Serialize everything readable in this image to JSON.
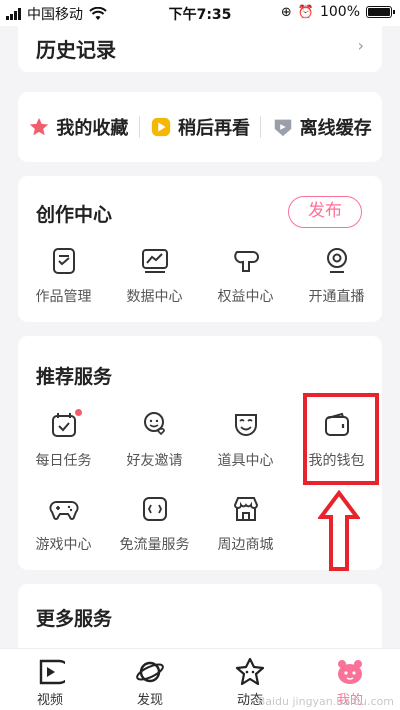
{
  "status_bar": {
    "carrier": "中国移动",
    "time": "下午7:35",
    "battery": "100%",
    "battery_level": 1.0
  },
  "history": {
    "title": "历史记录",
    "chevron": "›"
  },
  "quick_actions": [
    {
      "label": "我的收藏",
      "icon": "star-icon",
      "color": "#f25d6e"
    },
    {
      "label": "稍后再看",
      "icon": "watch-later-icon",
      "color": "#f5b800"
    },
    {
      "label": "离线缓存",
      "icon": "download-icon",
      "color": "#9aa0aa"
    }
  ],
  "creation_center": {
    "title": "创作中心",
    "publish_label": "发布",
    "items": [
      {
        "label": "作品管理",
        "icon": "works-icon"
      },
      {
        "label": "数据中心",
        "icon": "data-chart-icon"
      },
      {
        "label": "权益中心",
        "icon": "benefits-icon"
      },
      {
        "label": "开通直播",
        "icon": "live-camera-icon"
      }
    ]
  },
  "recommended": {
    "title": "推荐服务",
    "items": [
      {
        "label": "每日任务",
        "icon": "calendar-task-icon",
        "badge": true
      },
      {
        "label": "好友邀请",
        "icon": "friend-invite-icon"
      },
      {
        "label": "道具中心",
        "icon": "mask-icon"
      },
      {
        "label": "我的钱包",
        "icon": "wallet-icon"
      },
      {
        "label": "游戏中心",
        "icon": "gamepad-icon"
      },
      {
        "label": "免流量服务",
        "icon": "free-data-icon"
      },
      {
        "label": "周边商城",
        "icon": "shop-icon"
      }
    ]
  },
  "more_services": {
    "title": "更多服务"
  },
  "bottom_nav": [
    {
      "label": "视频",
      "icon": "video-icon"
    },
    {
      "label": "发现",
      "icon": "planet-icon"
    },
    {
      "label": "动态",
      "icon": "star-face-icon"
    },
    {
      "label": "我的",
      "icon": "profile-mascot-icon",
      "active": true
    }
  ],
  "colors": {
    "accent": "#fb7299",
    "annotation": "#e8232b"
  },
  "watermark": "Baidu jingyan.baidu.com"
}
